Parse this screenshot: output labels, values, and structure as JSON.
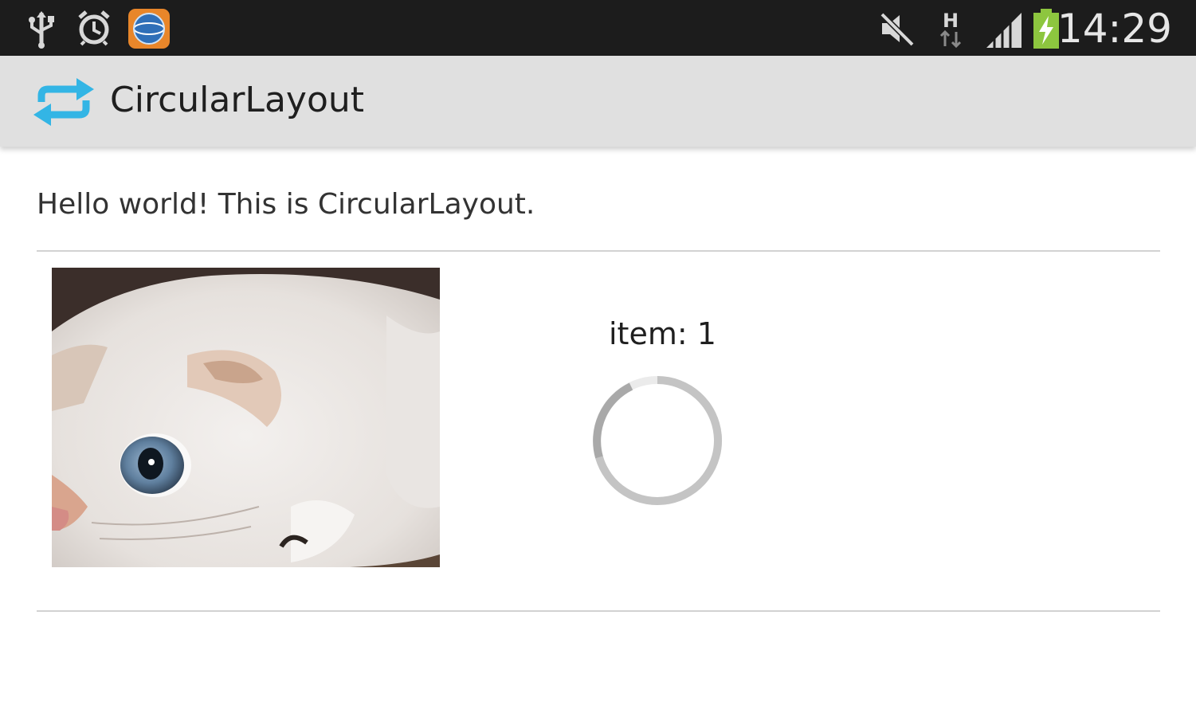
{
  "status_bar": {
    "time": "14:29",
    "notification_icons": [
      "usb-icon",
      "alarm-clock-icon",
      "app-notification-icon"
    ],
    "system_icons": [
      "mute-icon",
      "hspa-data-icon",
      "signal-icon",
      "battery-charging-icon"
    ],
    "network_type": "H",
    "colors": {
      "background": "#1c1c1c",
      "battery_fill": "#8dc63f"
    }
  },
  "action_bar": {
    "title": "CircularLayout",
    "icon": "repeat-arrows-icon",
    "colors": {
      "background": "#e0e0e0",
      "icon": "#33b5e5"
    }
  },
  "content": {
    "hello_text": "Hello world! This is CircularLayout.",
    "item": {
      "label": "item: 1",
      "image": "cat-photo",
      "loading_indicator": "circular-progress-spinner"
    }
  }
}
